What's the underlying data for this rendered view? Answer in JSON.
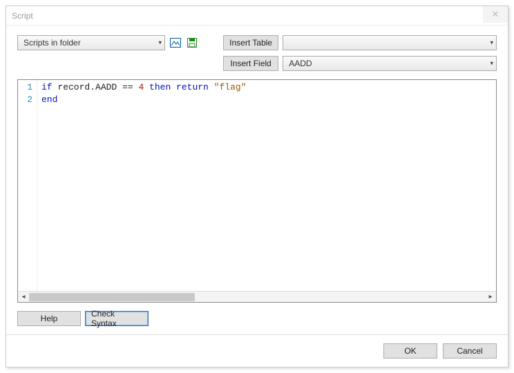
{
  "title": "Script",
  "scripts_combo": {
    "value": "Scripts in folder"
  },
  "insert_table": {
    "label": "Insert Table",
    "value": ""
  },
  "insert_field": {
    "label": "Insert Field",
    "value": "AADD"
  },
  "editor": {
    "lines": [
      {
        "n": 1,
        "tokens": [
          {
            "t": "if ",
            "c": "kw"
          },
          {
            "t": "record.AADD ",
            "c": "ident"
          },
          {
            "t": "== ",
            "c": "ident"
          },
          {
            "t": "4 ",
            "c": "num"
          },
          {
            "t": "then return ",
            "c": "kw"
          },
          {
            "t": "\"flag\"",
            "c": "str"
          }
        ]
      },
      {
        "n": 2,
        "tokens": [
          {
            "t": "end",
            "c": "kw"
          }
        ]
      }
    ]
  },
  "buttons": {
    "help": "Help",
    "check_syntax": "Check Syntax",
    "ok": "OK",
    "cancel": "Cancel"
  }
}
